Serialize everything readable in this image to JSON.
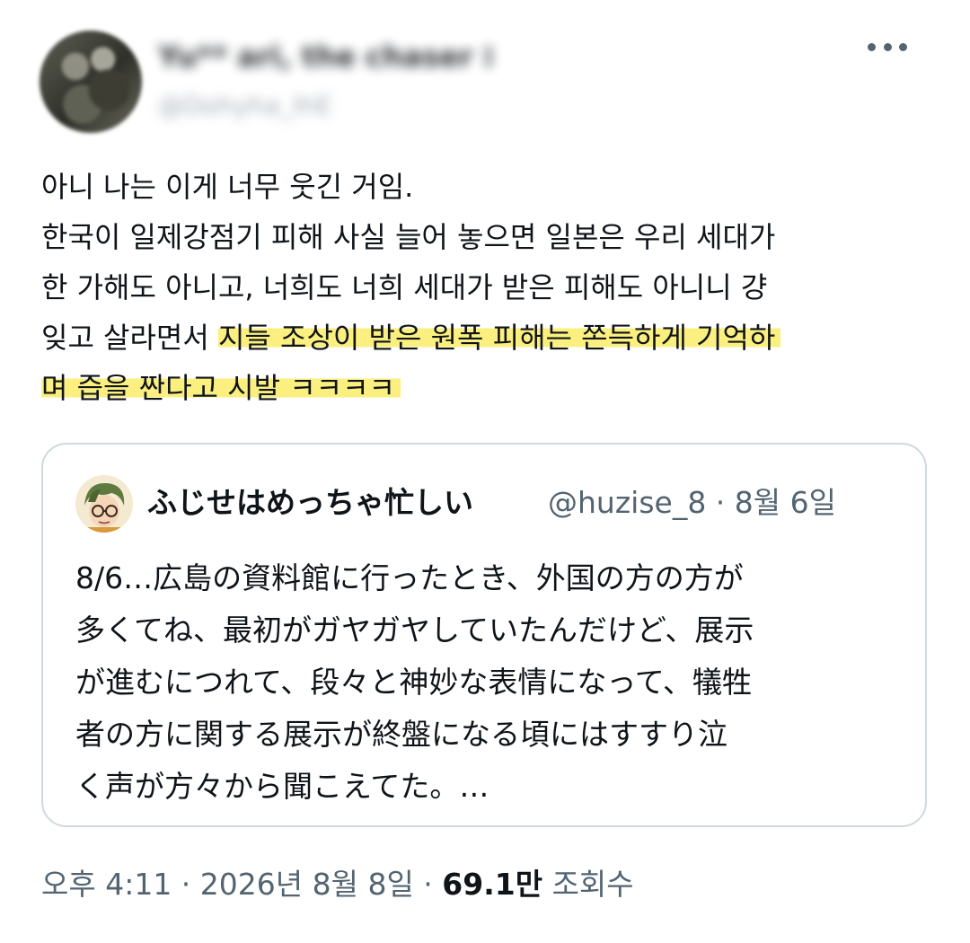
{
  "author": {
    "display_name": "Yu** ari, the chaser ⁝",
    "handle": "@Dohyha_IhE"
  },
  "menu": {
    "icon": "more-horizontal-icon"
  },
  "tweet": {
    "lines": [
      "아니 나는 이게 너무 웃긴 거임.",
      "한국이 일제강점기 피해 사실 늘어 놓으면 일본은 우리 세대가",
      "한 가해도 아니고, 너희도 너희 세대가 받은 피해도 아니니 걍"
    ],
    "line4_plain": "잊고 살라면서 ",
    "line4_highlight": "지들 조상이 받은 원폭 피해는 쫀득하게 기억하",
    "line5_highlight": "며 즙을 짠다고 시발 ㅋㅋㅋㅋ",
    "highlight_color": "#fbf07f"
  },
  "quote": {
    "display_name": "ふじせはめっちゃ忙しい",
    "handle_date": "@huzise_8 · 8월 6일",
    "lines": [
      "8/6…広島の資料館に行ったとき、外国の方の方が",
      "多くてね、最初がガヤガヤしていたんだけど、展示",
      "が進むにつれて、段々と神妙な表情になって、犠牲",
      "者の方に関する展示が終盤になる頃にはすすり泣",
      "く声が方々から聞こえてた。…"
    ],
    "border_color": "#cfd9de"
  },
  "meta": {
    "time_date": "오후 4:11 · 2026년 8월 8일 · ",
    "views_count": "69.1만",
    "views_label": " 조회수"
  }
}
